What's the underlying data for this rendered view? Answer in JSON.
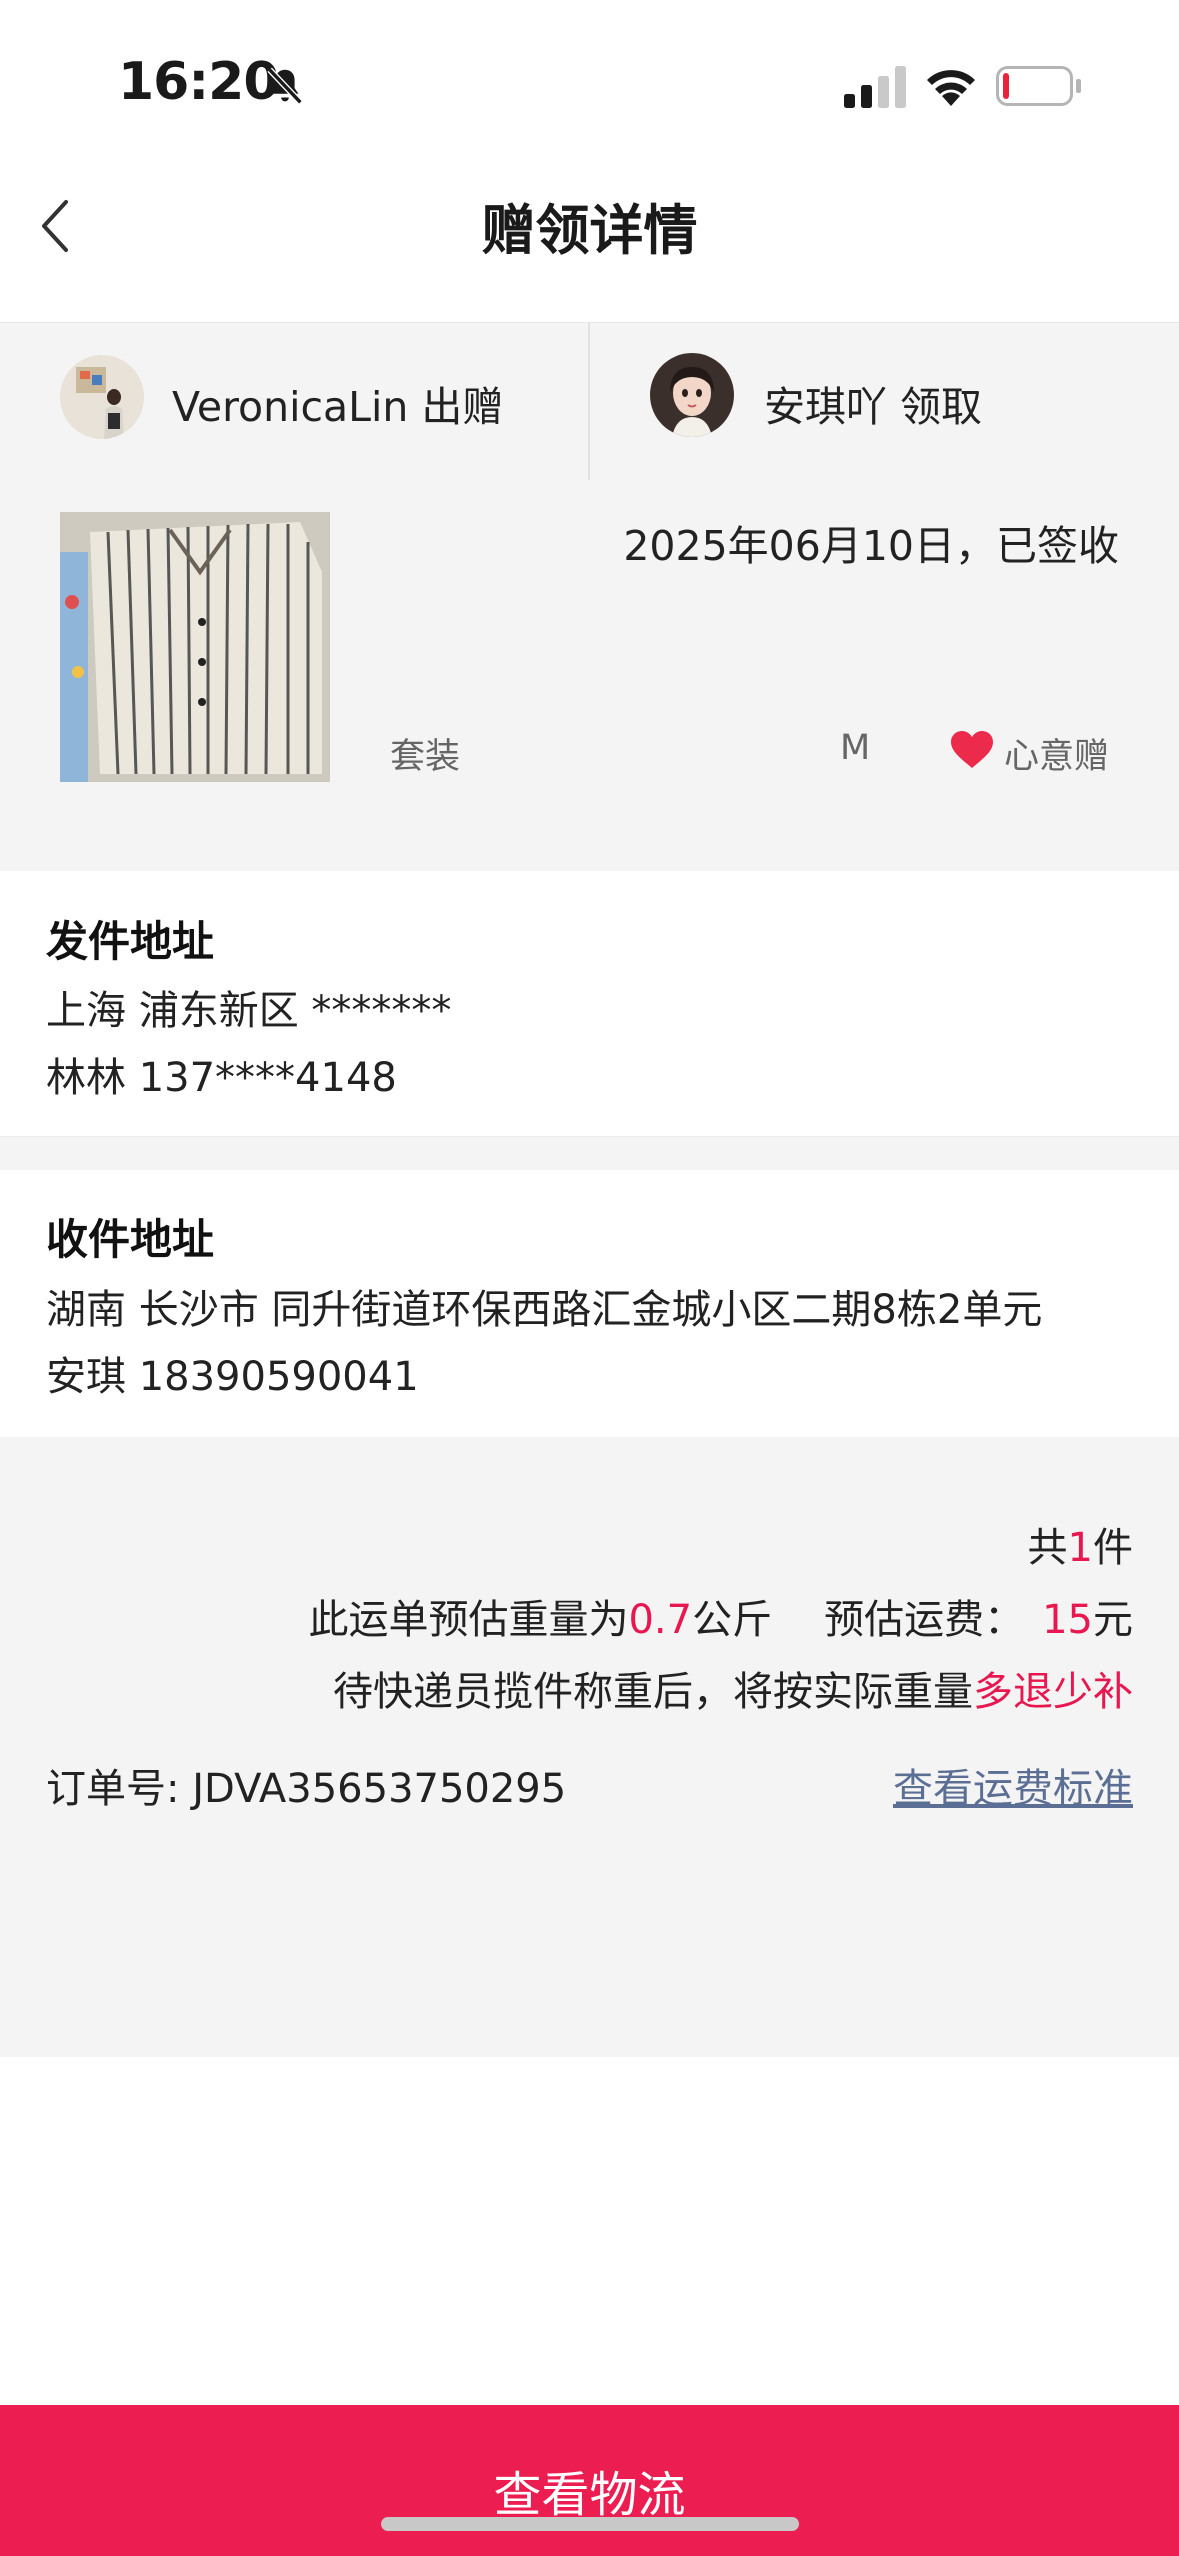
{
  "status_bar": {
    "time": "16:20"
  },
  "nav": {
    "title": "赠领详情"
  },
  "giver": {
    "label": "VeronicaLin 出赠"
  },
  "receiver": {
    "label": "安琪吖 领取"
  },
  "product": {
    "date_status": "2025年06月10日，已签收",
    "category": "套装",
    "size": "M",
    "gift_type": "心意赠"
  },
  "sender_address": {
    "heading": "发件地址",
    "address": "上海 浦东新区 *******",
    "contact": "林林 137****4148"
  },
  "receiver_address": {
    "heading": "收件地址",
    "address": "湖南 长沙市 同升街道环保西路汇金城小区二期8栋2单元",
    "contact": "安琪 18390590041"
  },
  "summary": {
    "count_prefix": "共",
    "count_value": "1",
    "count_suffix": "件",
    "weight_prefix": "此运单预估重量为",
    "weight_value": "0.7",
    "weight_unit": "公斤",
    "fee_label": "预估运费：",
    "fee_value": "15",
    "fee_unit": "元",
    "note_prefix": "待快递员揽件称重后，将按实际重量",
    "note_highlight": "多退少补",
    "order_label": "订单号:",
    "order_number": "JDVA35653750295",
    "freight_link": "查看运费标准"
  },
  "bottom_button": {
    "label": "查看物流"
  },
  "colors": {
    "accent": "#ec1d51",
    "highlight_text": "#e8174f",
    "link": "#5b6f95",
    "band_bg": "#f4f4f4"
  }
}
